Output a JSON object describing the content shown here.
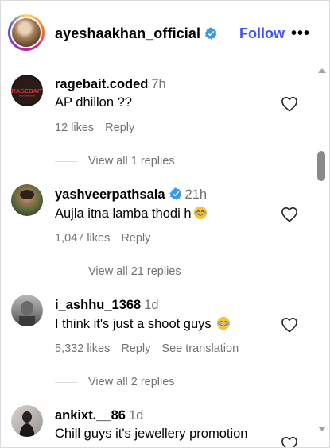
{
  "header": {
    "username": "ayeshaakhan_official",
    "follow_label": "Follow",
    "more_label": "•••"
  },
  "colors": {
    "accent": "#4150f7",
    "muted": "#737373",
    "verified": "#3897f0"
  },
  "comments": [
    {
      "username": "ragebait.coded",
      "time": "7h",
      "text": "AP dhillon ??",
      "likes": "12 likes",
      "reply": "Reply",
      "view_replies": "View all 1 replies",
      "avatar_text": "RAGEBAIT"
    },
    {
      "username": "yashveerpathsala",
      "verified": true,
      "time": "21h",
      "text": "Aujla itna lamba thodi h",
      "emoji": "rolling-laughing",
      "likes": "1,047 likes",
      "reply": "Reply",
      "view_replies": "View all 21 replies"
    },
    {
      "username": "i_ashhu_1368",
      "time": "1d",
      "text": "I think it's just a shoot guys",
      "emoji": "rolling-laughing",
      "likes": "5,332 likes",
      "reply": "Reply",
      "see_translation": "See translation",
      "view_replies": "View all 2 replies"
    },
    {
      "username": "ankixt.__86",
      "time": "1d",
      "text": "Chill guys it's jewellery promotion"
    }
  ]
}
